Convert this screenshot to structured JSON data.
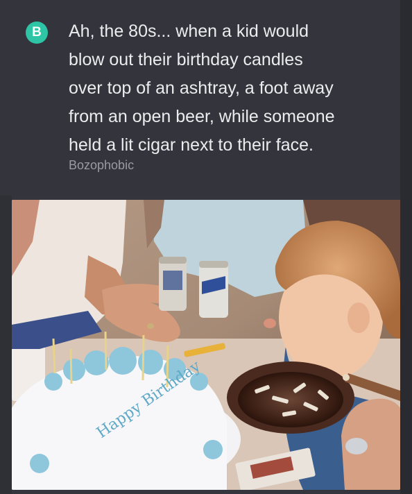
{
  "post": {
    "badge_letter": "B",
    "lines": [
      "Ah, the 80s... when a kid would",
      "blow out their birthday candles",
      "over top of an ashtray, a foot away",
      "from an open beer, while someone",
      "held a lit cigar next to their face."
    ],
    "author": "Bozophobic"
  },
  "photo": {
    "cake_text": "Happy Birthday"
  },
  "colors": {
    "card_bg": "#34353c",
    "badge": "#2ec4a6",
    "text": "#ececee",
    "author": "#9a9ba2"
  }
}
